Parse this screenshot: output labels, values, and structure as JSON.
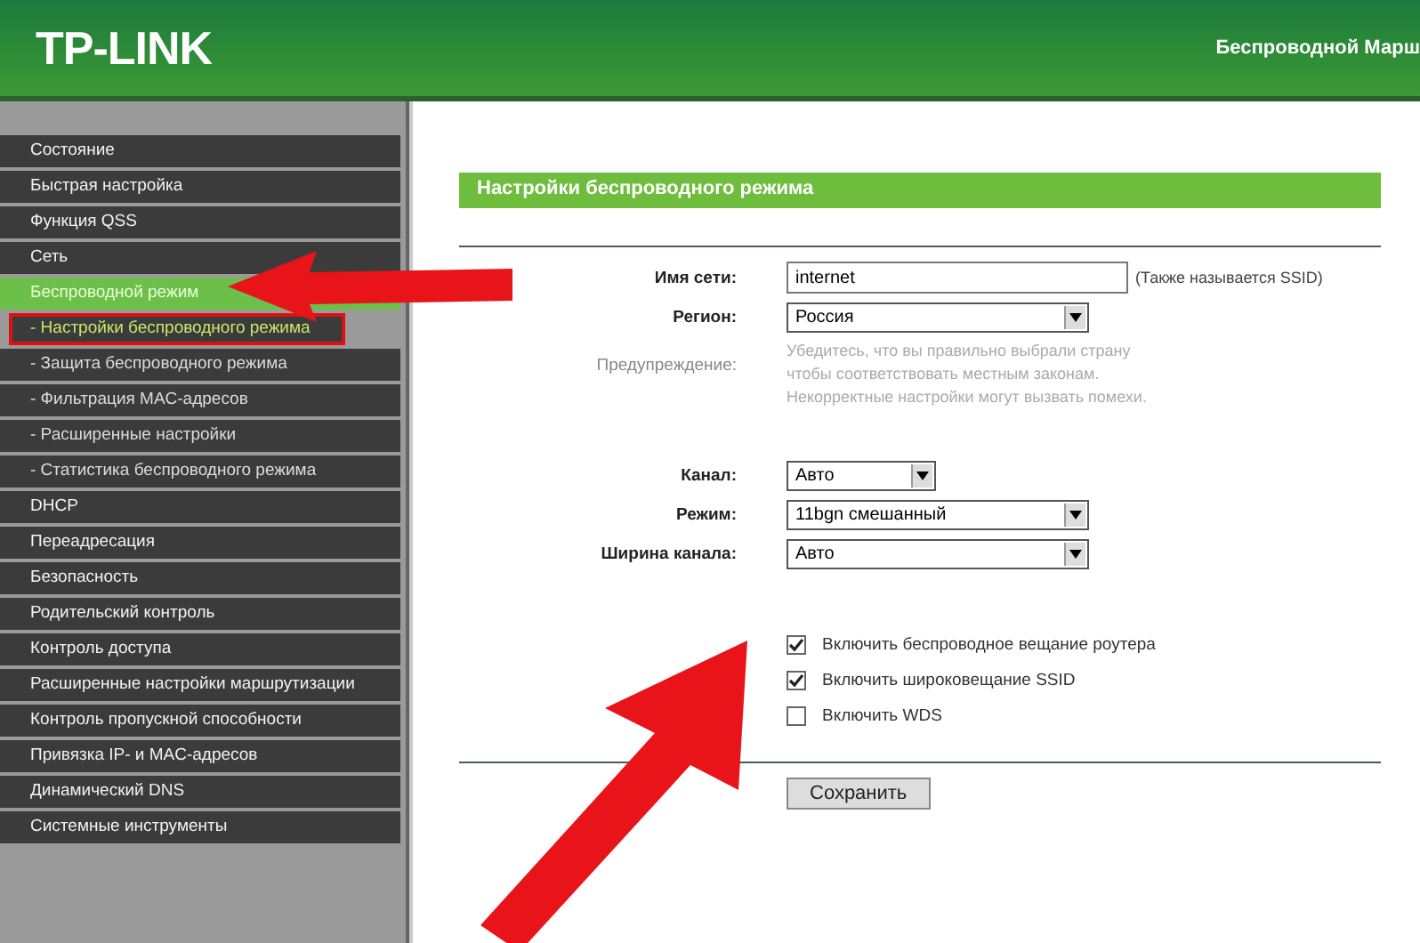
{
  "header": {
    "logo": "TP-LINK",
    "title": "Беспроводной Марш"
  },
  "sidebar": {
    "items": [
      {
        "label": "Состояние",
        "kind": "main",
        "selected": false,
        "highlighted": false
      },
      {
        "label": "Быстрая настройка",
        "kind": "main",
        "selected": false,
        "highlighted": false
      },
      {
        "label": "Функция QSS",
        "kind": "main",
        "selected": false,
        "highlighted": false
      },
      {
        "label": "Сеть",
        "kind": "main",
        "selected": false,
        "highlighted": false
      },
      {
        "label": "Беспроводной режим",
        "kind": "main",
        "selected": true,
        "highlighted": false
      },
      {
        "label": "- Настройки беспроводного режима",
        "kind": "sub",
        "selected": true,
        "highlighted": true
      },
      {
        "label": "- Защита беспроводного режима",
        "kind": "sub",
        "selected": false,
        "highlighted": false
      },
      {
        "label": "- Фильтрация MAC-адресов",
        "kind": "sub",
        "selected": false,
        "highlighted": false
      },
      {
        "label": "- Расширенные настройки",
        "kind": "sub",
        "selected": false,
        "highlighted": false
      },
      {
        "label": "- Статистика беспроводного режима",
        "kind": "sub",
        "selected": false,
        "highlighted": false
      },
      {
        "label": "DHCP",
        "kind": "main",
        "selected": false,
        "highlighted": false
      },
      {
        "label": "Переадресация",
        "kind": "main",
        "selected": false,
        "highlighted": false
      },
      {
        "label": "Безопасность",
        "kind": "main",
        "selected": false,
        "highlighted": false
      },
      {
        "label": "Родительский контроль",
        "kind": "main",
        "selected": false,
        "highlighted": false
      },
      {
        "label": "Контроль доступа",
        "kind": "main",
        "selected": false,
        "highlighted": false
      },
      {
        "label": "Расширенные настройки маршрутизации",
        "kind": "main",
        "selected": false,
        "highlighted": false
      },
      {
        "label": "Контроль пропускной способности",
        "kind": "main",
        "selected": false,
        "highlighted": false
      },
      {
        "label": "Привязка IP- и MAC-адресов",
        "kind": "main",
        "selected": false,
        "highlighted": false
      },
      {
        "label": "Динамический DNS",
        "kind": "main",
        "selected": false,
        "highlighted": false
      },
      {
        "label": "Системные инструменты",
        "kind": "main",
        "selected": false,
        "highlighted": false
      }
    ]
  },
  "form": {
    "title": "Настройки беспроводного режима",
    "fields": [
      {
        "kind": "text",
        "label": "Имя сети:",
        "value": "internet",
        "hint": "(Также называется SSID)"
      },
      {
        "kind": "select",
        "label": "Регион:",
        "value": "Россия"
      },
      {
        "kind": "note",
        "label": "Предупреждение:",
        "lines": [
          "Убедитесь, что вы правильно выбрали страну",
          "чтобы соответствовать местным законам.",
          "Некорректные настройки могут вызвать помехи."
        ]
      },
      {
        "kind": "short-select",
        "label": "Канал:",
        "value": "Авто"
      },
      {
        "kind": "select",
        "label": "Режим:",
        "value": "11bgn смешанный"
      },
      {
        "kind": "select",
        "label": "Ширина канала:",
        "value": "Авто"
      }
    ],
    "checkboxes": [
      {
        "label": "Включить беспроводное вещание роутера",
        "checked": true
      },
      {
        "label": "Включить широковещание SSID",
        "checked": true
      },
      {
        "label": "Включить WDS",
        "checked": false
      }
    ],
    "save_button": "Сохранить"
  }
}
